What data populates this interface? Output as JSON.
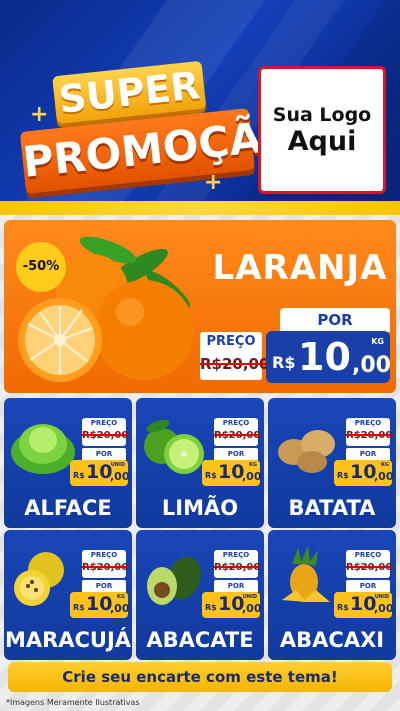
{
  "header": {
    "title_line1": "SUPER",
    "title_line2": "PROMOÇÃO",
    "logo_line1": "Sua Logo",
    "logo_line2": "Aqui"
  },
  "colors": {
    "header_blue": "#123fb8",
    "orange": "#f06a00",
    "yellow": "#ffc21a",
    "price_blue": "#1a3fa6",
    "card_blue": "#1946b8"
  },
  "featured": {
    "name": "LARANJA",
    "discount": "-50%",
    "old_label": "PREÇO",
    "old_price": "R$20,00",
    "por_label": "POR",
    "currency": "R$",
    "price_int": "10",
    "price_cents": ",00",
    "unit": "KG",
    "icon": "orange-fruit-icon"
  },
  "products": [
    {
      "name": "ALFACE",
      "old_label": "PREÇO",
      "old_price": "R$20,00",
      "por_label": "POR",
      "currency": "R$",
      "price_int": "10",
      "price_cents": ",00",
      "unit": "UNID",
      "icon": "lettuce-icon"
    },
    {
      "name": "LIMÃO",
      "old_label": "PREÇO",
      "old_price": "R$20,00",
      "por_label": "POR",
      "currency": "R$",
      "price_int": "10",
      "price_cents": ",00",
      "unit": "KG",
      "icon": "lime-icon"
    },
    {
      "name": "BATATA",
      "old_label": "PREÇO",
      "old_price": "R$20,00",
      "por_label": "POR",
      "currency": "R$",
      "price_int": "10",
      "price_cents": ",00",
      "unit": "KG",
      "icon": "potato-icon"
    },
    {
      "name": "MARACUJÁ",
      "old_label": "PREÇO",
      "old_price": "R$20,00",
      "por_label": "POR",
      "currency": "R$",
      "price_int": "10",
      "price_cents": ",00",
      "unit": "KG",
      "icon": "passion-fruit-icon"
    },
    {
      "name": "ABACATE",
      "old_label": "PREÇO",
      "old_price": "R$20,00",
      "por_label": "POR",
      "currency": "R$",
      "price_int": "10",
      "price_cents": ",00",
      "unit": "UNID",
      "icon": "avocado-icon"
    },
    {
      "name": "ABACAXI",
      "old_label": "PREÇO",
      "old_price": "R$20,00",
      "por_label": "POR",
      "currency": "R$",
      "price_int": "10",
      "price_cents": ",00",
      "unit": "UNID",
      "icon": "pineapple-icon"
    }
  ],
  "cta": "Crie seu encarte com este tema!",
  "footnote": "*Imagens Meramente Ilustrativas"
}
